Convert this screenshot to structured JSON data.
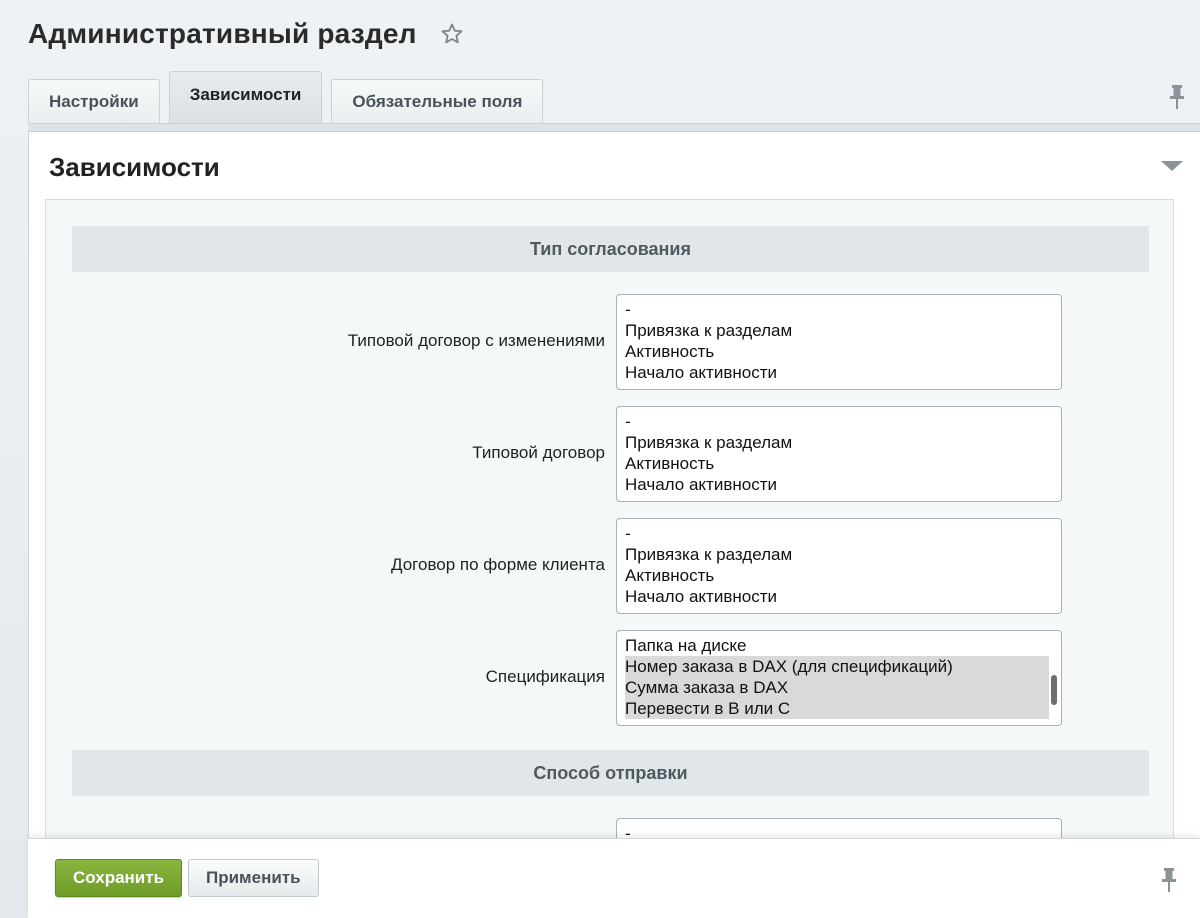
{
  "header": {
    "title": "Административный раздел",
    "favorite_icon": "star-icon"
  },
  "tabs": [
    {
      "label": "Настройки",
      "active": false
    },
    {
      "label": "Зависимости",
      "active": true
    },
    {
      "label": "Обязательные поля",
      "active": false
    }
  ],
  "section": {
    "title": "Зависимости"
  },
  "groups": {
    "approval": {
      "title": "Тип согласования"
    },
    "sending": {
      "title": "Способ отправки"
    }
  },
  "fields": [
    {
      "label": "Типовой договор с изменениями",
      "options": [
        "-",
        "Привязка к разделам",
        "Активность",
        "Начало активности"
      ]
    },
    {
      "label": "Типовой договор",
      "options": [
        "-",
        "Привязка к разделам",
        "Активность",
        "Начало активности"
      ]
    },
    {
      "label": "Договор по форме клиента",
      "options": [
        "-",
        "Привязка к разделам",
        "Активность",
        "Начало активности"
      ]
    },
    {
      "label": "Спецификация",
      "options": [
        "Папка на диске",
        "Номер заказа в DAX (для спецификаций)",
        "Сумма заказа в DAX",
        "Перевести в В или С"
      ],
      "selected": [
        1,
        2,
        3
      ]
    }
  ],
  "sending_field": {
    "options": [
      "-"
    ]
  },
  "footer": {
    "save_label": "Сохранить",
    "apply_label": "Применить"
  },
  "colors": {
    "save_button": "#7aa733",
    "group_header_bg": "#e1e7e9",
    "selected_option_bg": "#d9d9d9"
  }
}
